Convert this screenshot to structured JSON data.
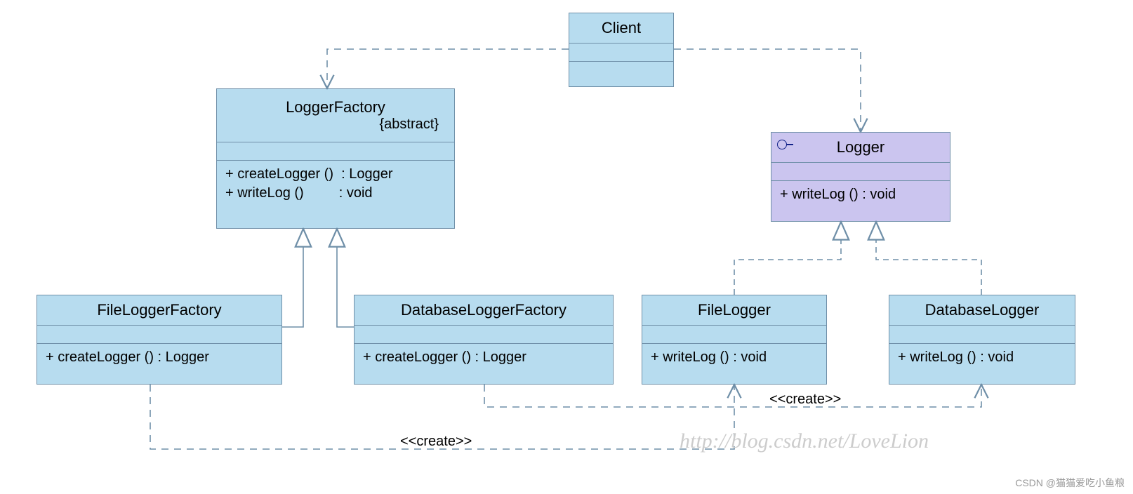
{
  "client": {
    "name": "Client"
  },
  "loggerFactory": {
    "name": "LoggerFactory",
    "stereotype": "{abstract}",
    "op1": "+ createLogger ()  : Logger",
    "op2": "+ writeLog ()         : void"
  },
  "logger": {
    "name": "Logger",
    "op1": "+ writeLog () : void"
  },
  "fileLoggerFactory": {
    "name": "FileLoggerFactory",
    "op1": "+ createLogger () : Logger"
  },
  "databaseLoggerFactory": {
    "name": "DatabaseLoggerFactory",
    "op1": "+ createLogger () : Logger"
  },
  "fileLogger": {
    "name": "FileLogger",
    "op1": "+ writeLog () : void"
  },
  "databaseLogger": {
    "name": "DatabaseLogger",
    "op1": "+ writeLog () : void"
  },
  "labels": {
    "create1": "<<create>>",
    "create2": "<<create>>"
  },
  "watermark": "http://blog.csdn.net/LoveLion",
  "credit": "CSDN @猫猫爱吃小鱼粮"
}
